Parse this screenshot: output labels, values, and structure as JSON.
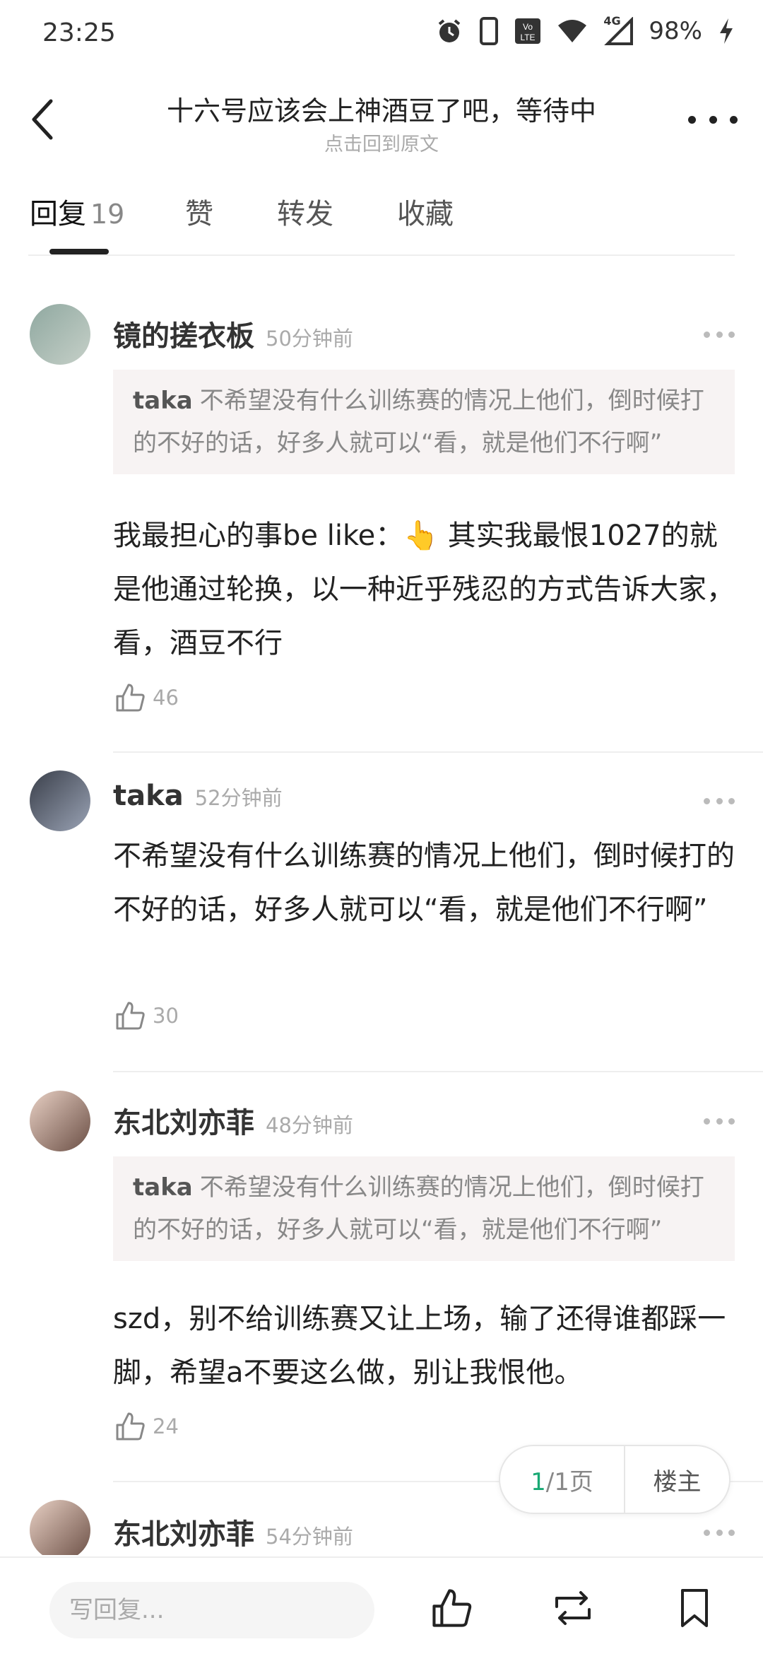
{
  "status_bar": {
    "time": "23:25",
    "network": "4G",
    "battery": "98%",
    "icons": [
      "alarm-icon",
      "phone-icon",
      "volte-icon",
      "wifi-icon",
      "signal-icon",
      "charging-icon"
    ]
  },
  "header": {
    "title": "十六号应该会上神酒豆了吧，等待中",
    "subtitle": "点击回到原文"
  },
  "tabs": [
    {
      "label": "回复",
      "count": "19"
    },
    {
      "label": "赞"
    },
    {
      "label": "转发"
    },
    {
      "label": "收藏"
    }
  ],
  "comments": [
    {
      "username": "镜的搓衣板",
      "time": "50分钟前",
      "quote_name": "taka",
      "quote_text": "不希望没有什么训练赛的情况上他们，倒时候打的不好的话，好多人就可以“看，就是他们不行啊”",
      "text": "我最担心的事be like：👆 其实我最恨1027的就是他通过轮换，以一种近乎残忍的方式告诉大家，看，酒豆不行",
      "likes": "46"
    },
    {
      "username": "taka",
      "time": "52分钟前",
      "text": "不希望没有什么训练赛的情况上他们，倒时候打的不好的话，好多人就可以“看，就是他们不行啊”",
      "likes": "30"
    },
    {
      "username": "东北刘亦菲",
      "time": "48分钟前",
      "quote_name": "taka",
      "quote_text": "不希望没有什么训练赛的情况上他们，倒时候打的不好的话，好多人就可以“看，就是他们不行啊”",
      "text": "szd，别不给训练赛又让上场，输了还得谁都踩一脚，希望a不要这么做，别让我恨他。",
      "likes": "24"
    },
    {
      "username": "东北刘亦菲",
      "time": "54分钟前"
    }
  ],
  "pager": {
    "current": "1",
    "total": "/1页",
    "owner_label": "楼主"
  },
  "bottom_bar": {
    "reply_placeholder": "写回复..."
  },
  "colors": {
    "accent_green": "#19a974",
    "quote_bg": "#f7f3f3"
  }
}
